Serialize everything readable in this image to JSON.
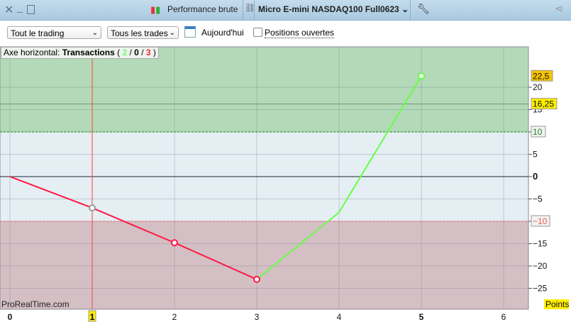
{
  "titlebar": {
    "performance": "Performance brute",
    "instrument": "Micro E-mini NASDAQ100 Full0623"
  },
  "toolbar": {
    "period": "Tout le trading",
    "trades": "Tous les trades",
    "today": "Aujourd'hui",
    "open_positions": "Positions ouvertes",
    "open_positions_checked": false
  },
  "legend": {
    "prefix": "Axe horizontal:",
    "axis": "Transactions",
    "open": "(",
    "wins": "2",
    "sep1": "/",
    "neutral": "0",
    "sep2": "/",
    "losses": "3",
    "close": ")"
  },
  "watermark": "ProRealTime.com",
  "colors": {
    "gain": "#66ff44",
    "loss": "#ff1744",
    "zone_gain": "#b3dab8",
    "zone_mid": "#e4eef3",
    "zone_loss": "#d4bfc4"
  },
  "chart_data": {
    "type": "line",
    "x": [
      0,
      1,
      2,
      3,
      4,
      5
    ],
    "y": [
      0,
      -7,
      -14.8,
      -23,
      -8,
      22.5
    ],
    "xlim": [
      0,
      6.3
    ],
    "ylim": [
      -29.5,
      29
    ],
    "xticks": [
      "0",
      "1",
      "2",
      "3",
      "4",
      "5",
      "6"
    ],
    "yticks": [
      "20",
      "15",
      "10",
      "5",
      "0",
      "-5",
      "-10",
      "-15",
      "-20",
      "-25"
    ],
    "ylabel": "Points",
    "thresholds": {
      "upper": 10,
      "lower": -10,
      "upper_label": "10",
      "lower_label": "-10"
    },
    "markers": {
      "last_value": "22,5",
      "average": "16,25",
      "average_value": 16.25
    },
    "cursor_x": 1,
    "cursor_label": "1",
    "grid": true
  }
}
